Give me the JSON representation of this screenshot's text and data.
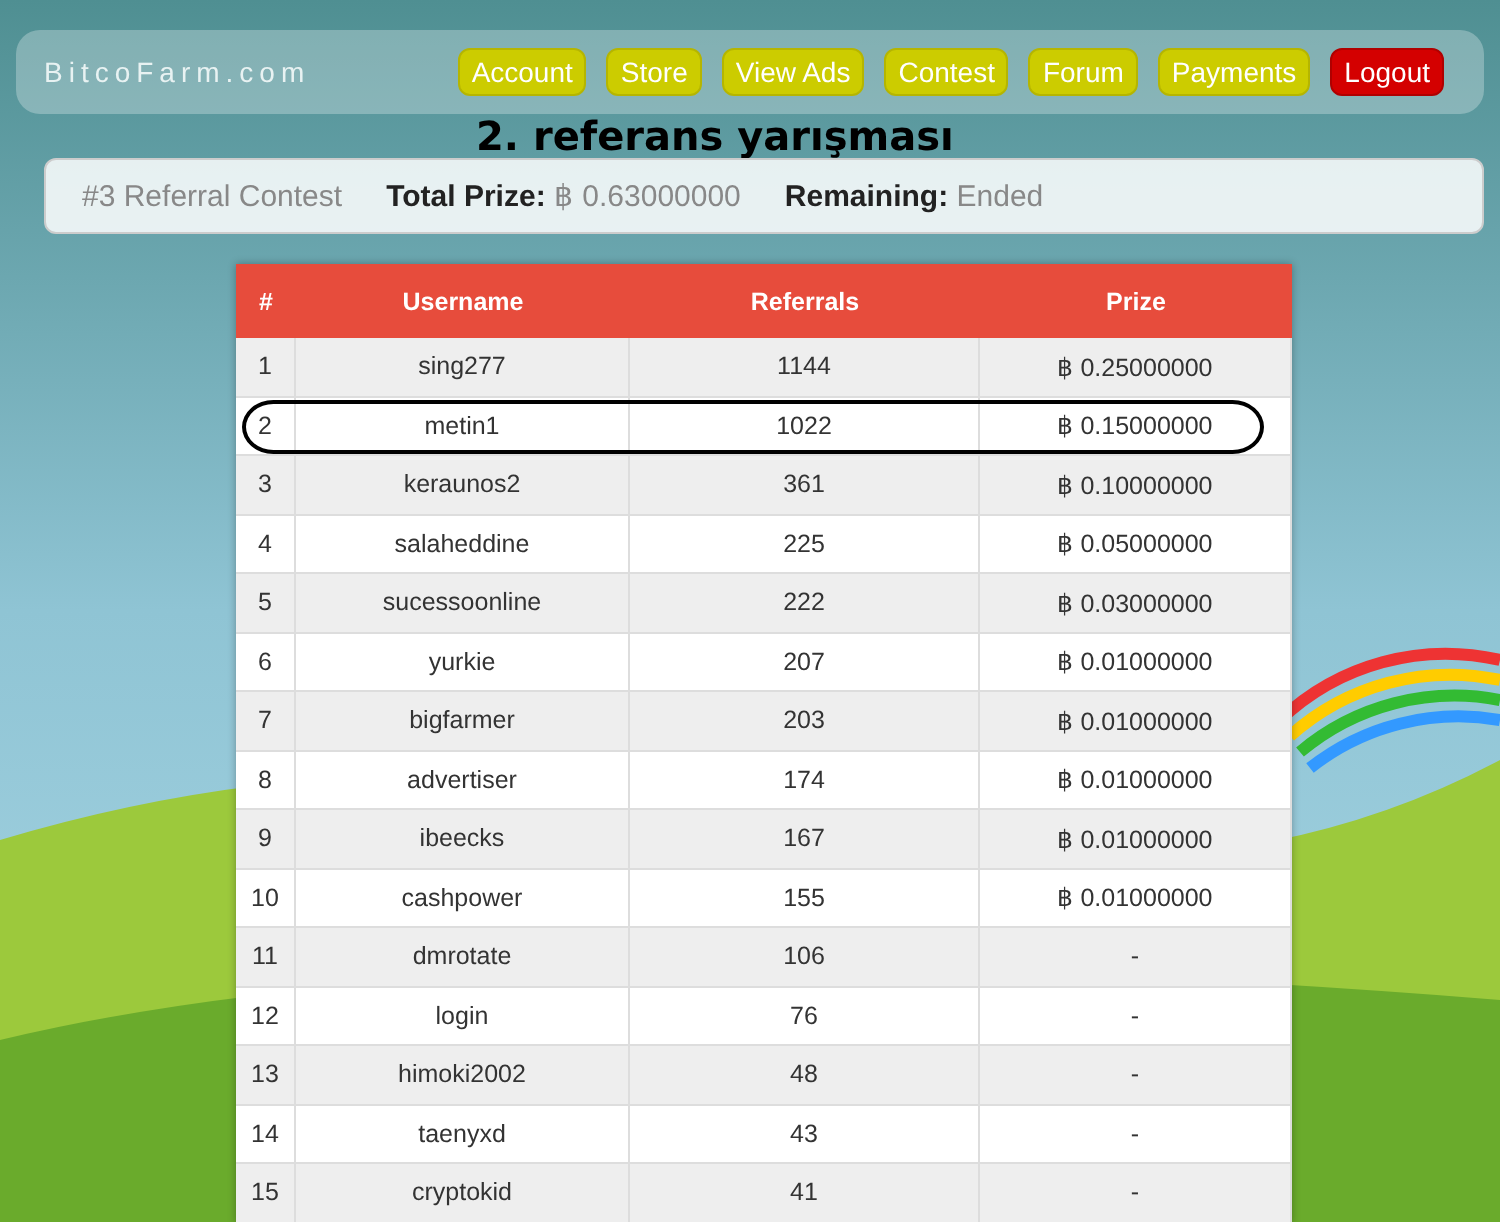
{
  "header": {
    "logo": "BitcoFarm.com",
    "nav": [
      {
        "label": "Account",
        "kind": "nav"
      },
      {
        "label": "Store",
        "kind": "nav"
      },
      {
        "label": "View Ads",
        "kind": "nav"
      },
      {
        "label": "Contest",
        "kind": "nav"
      },
      {
        "label": "Forum",
        "kind": "nav"
      },
      {
        "label": "Payments",
        "kind": "nav"
      },
      {
        "label": "Logout",
        "kind": "logout"
      }
    ]
  },
  "annotation": "2. referans yarışması",
  "contest": {
    "title": "#3 Referral Contest",
    "total_prize_label": "Total Prize:",
    "total_prize": "฿ 0.63000000",
    "remaining_label": "Remaining:",
    "remaining": "Ended"
  },
  "table": {
    "columns": [
      "#",
      "Username",
      "Referrals",
      "Prize"
    ],
    "rows": [
      {
        "rank": "1",
        "username": "sing277",
        "referrals": "1144",
        "prize": "฿ 0.25000000",
        "circled": false
      },
      {
        "rank": "2",
        "username": "metin1",
        "referrals": "1022",
        "prize": "฿ 0.15000000",
        "circled": true
      },
      {
        "rank": "3",
        "username": "keraunos2",
        "referrals": "361",
        "prize": "฿ 0.10000000",
        "circled": false
      },
      {
        "rank": "4",
        "username": "salaheddine",
        "referrals": "225",
        "prize": "฿ 0.05000000",
        "circled": false
      },
      {
        "rank": "5",
        "username": "sucessoonline",
        "referrals": "222",
        "prize": "฿ 0.03000000",
        "circled": false
      },
      {
        "rank": "6",
        "username": "yurkie",
        "referrals": "207",
        "prize": "฿ 0.01000000",
        "circled": false
      },
      {
        "rank": "7",
        "username": "bigfarmer",
        "referrals": "203",
        "prize": "฿ 0.01000000",
        "circled": false
      },
      {
        "rank": "8",
        "username": "advertiser",
        "referrals": "174",
        "prize": "฿ 0.01000000",
        "circled": false
      },
      {
        "rank": "9",
        "username": "ibeecks",
        "referrals": "167",
        "prize": "฿ 0.01000000",
        "circled": false
      },
      {
        "rank": "10",
        "username": "cashpower",
        "referrals": "155",
        "prize": "฿ 0.01000000",
        "circled": false
      },
      {
        "rank": "11",
        "username": "dmrotate",
        "referrals": "106",
        "prize": "-",
        "circled": false
      },
      {
        "rank": "12",
        "username": "login",
        "referrals": "76",
        "prize": "-",
        "circled": false
      },
      {
        "rank": "13",
        "username": "himoki2002",
        "referrals": "48",
        "prize": "-",
        "circled": false
      },
      {
        "rank": "14",
        "username": "taenyxd",
        "referrals": "43",
        "prize": "-",
        "circled": false
      },
      {
        "rank": "15",
        "username": "cryptokid",
        "referrals": "41",
        "prize": "-",
        "circled": false
      }
    ]
  }
}
